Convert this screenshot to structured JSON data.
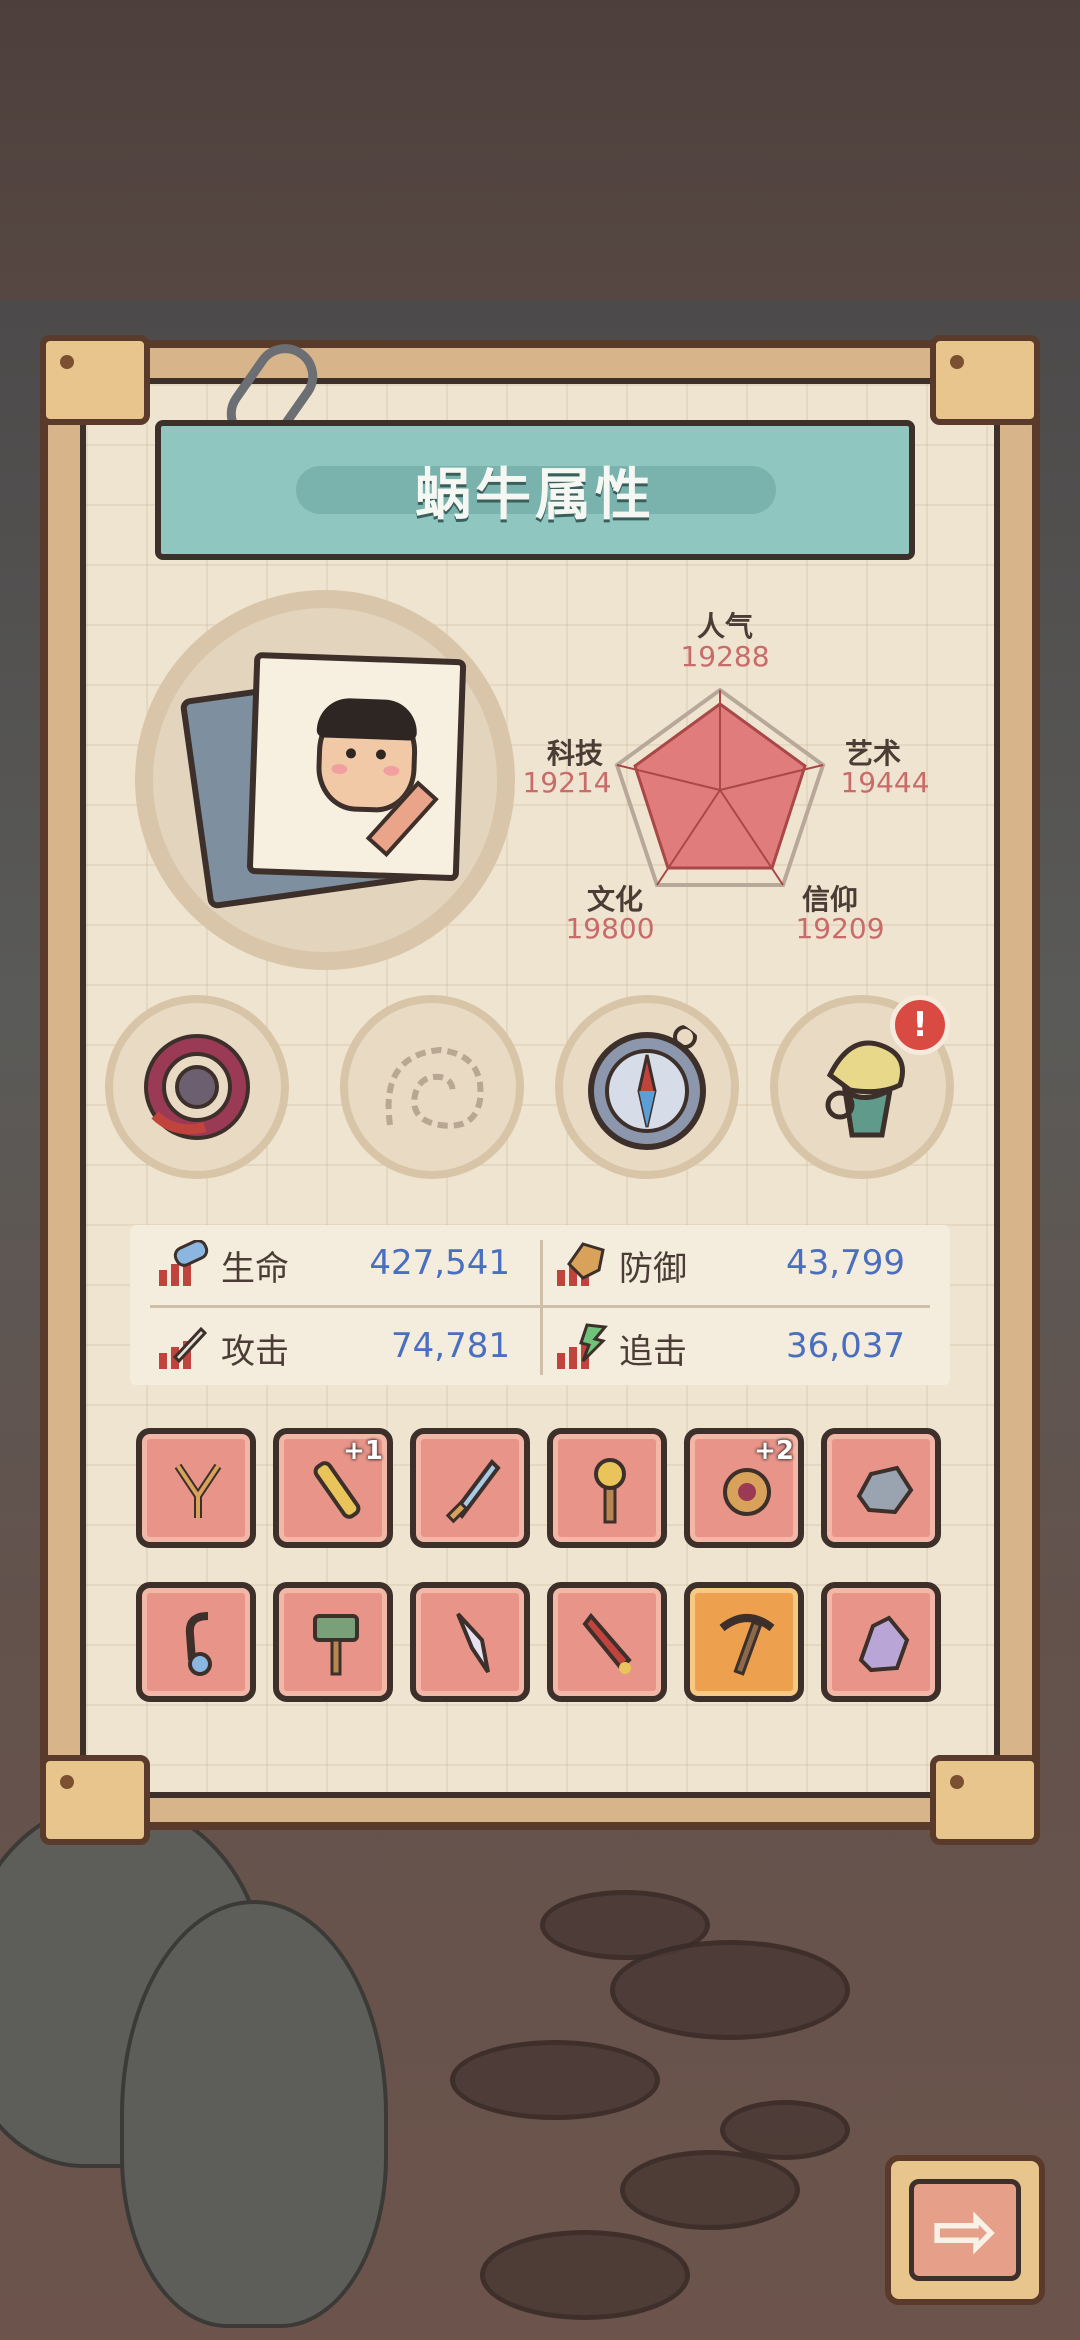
{
  "panel": {
    "title": "蜗牛属性"
  },
  "radar": {
    "stats": [
      {
        "name": "人气",
        "value": "19288"
      },
      {
        "name": "艺术",
        "value": "19444"
      },
      {
        "name": "信仰",
        "value": "19209"
      },
      {
        "name": "文化",
        "value": "19800"
      },
      {
        "name": "科技",
        "value": "19214"
      }
    ],
    "fill_color": "#e07c7c"
  },
  "equipment_circles": [
    {
      "icon": "thorn-ring-icon"
    },
    {
      "icon": "snail-shell-outline-icon"
    },
    {
      "icon": "compass-icon"
    },
    {
      "icon": "crystal-torch-icon",
      "alert": "!"
    }
  ],
  "attributes": [
    {
      "label": "生命",
      "value": "427,541",
      "icon": "potion-bar-icon"
    },
    {
      "label": "防御",
      "value": "43,799",
      "icon": "shield-bar-icon"
    },
    {
      "label": "攻击",
      "value": "74,781",
      "icon": "sword-bar-icon"
    },
    {
      "label": "追击",
      "value": "36,037",
      "icon": "lightning-bar-icon"
    }
  ],
  "items": [
    {
      "icon": "slingshot-icon",
      "plus": ""
    },
    {
      "icon": "golden-mace-icon",
      "plus": "+1"
    },
    {
      "icon": "blue-sword-icon",
      "plus": ""
    },
    {
      "icon": "skull-staff-icon",
      "plus": ""
    },
    {
      "icon": "gem-relic-icon",
      "plus": "+2"
    },
    {
      "icon": "ore-chunk-icon",
      "plus": ""
    },
    {
      "icon": "hook-icon",
      "plus": ""
    },
    {
      "icon": "war-hammer-icon",
      "plus": ""
    },
    {
      "icon": "crystal-dagger-icon",
      "plus": ""
    },
    {
      "icon": "rocket-blade-icon",
      "plus": ""
    },
    {
      "icon": "pickaxe-icon",
      "plus": ""
    },
    {
      "icon": "crystal-rock-icon",
      "plus": ""
    }
  ],
  "next_button": {
    "glyph": "⇨"
  },
  "colors": {
    "stat_value": "#4a6fc0",
    "radar_value": "#c96b6b",
    "slot": "#e89489",
    "slot_gold": "#eda14f"
  }
}
